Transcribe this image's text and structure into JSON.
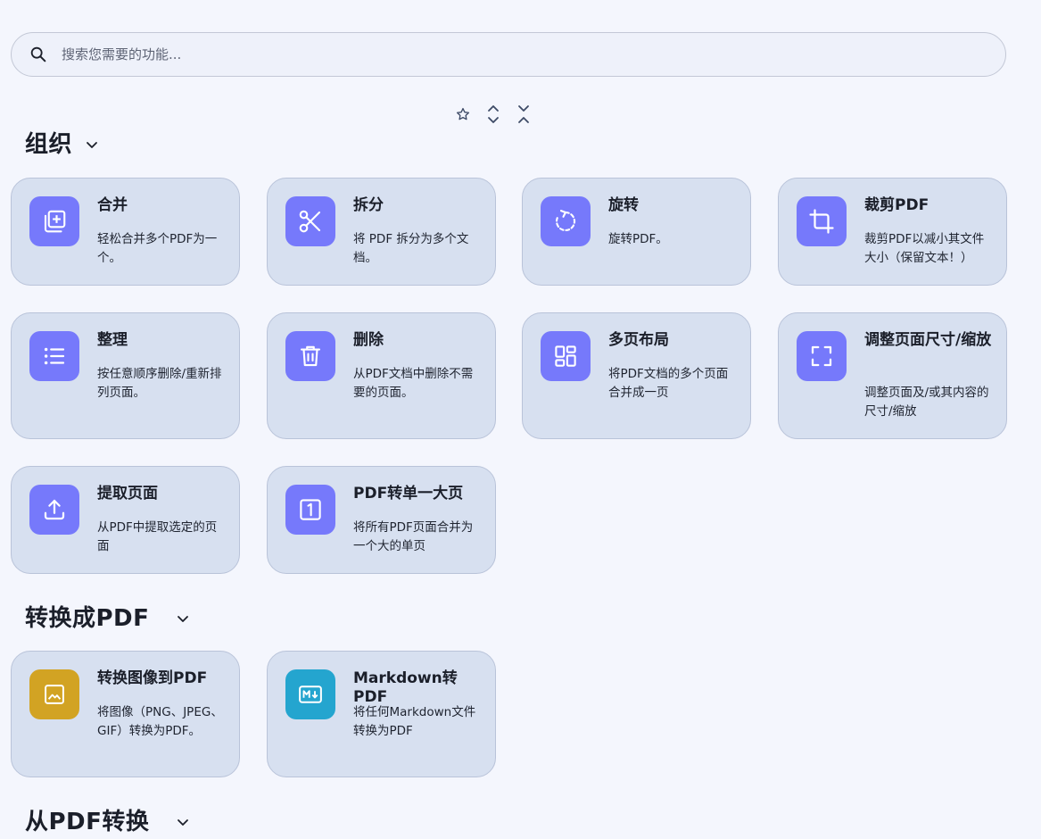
{
  "search": {
    "placeholder": "搜索您需要的功能..."
  },
  "sections": {
    "organize": {
      "title": "组织",
      "cards": {
        "merge": {
          "title": "合并",
          "desc": "轻松合并多个PDF为一个。"
        },
        "split": {
          "title": "拆分",
          "desc": "将 PDF 拆分为多个文档。"
        },
        "rotate": {
          "title": "旋转",
          "desc": "旋转PDF。"
        },
        "crop": {
          "title": "裁剪PDF",
          "desc": "裁剪PDF以减小其文件大小（保留文本！）"
        },
        "organize": {
          "title": "整理",
          "desc": "按任意顺序删除/重新排列页面。"
        },
        "remove": {
          "title": "删除",
          "desc": "从PDF文档中删除不需要的页面。"
        },
        "multi_page_layout": {
          "title": "多页布局",
          "desc": "将PDF文档的多个页面合并成一页"
        },
        "scale": {
          "title": "调整页面尺寸/缩放",
          "desc": "调整页面及/或其内容的尺寸/缩放"
        },
        "extract": {
          "title": "提取页面",
          "desc": "从PDF中提取选定的页面"
        },
        "single_page": {
          "title": "PDF转单一大页",
          "desc": "将所有PDF页面合并为一个大的单页"
        }
      }
    },
    "convert_to": {
      "title": "转换成PDF",
      "cards": {
        "image_to_pdf": {
          "title": "转换图像到PDF",
          "desc": "将图像（PNG、JPEG、GIF）转换为PDF。"
        },
        "markdown_to_pdf": {
          "title": "Markdown转PDF",
          "desc": "将任何Markdown文件转换为PDF"
        }
      }
    },
    "convert_from": {
      "title": "从PDF转换"
    }
  },
  "colors": {
    "accent": "#7679fb",
    "image_card_icon": "#d2a323",
    "markdown_card_icon": "#24a5cf",
    "card_bg": "#d7e0f0",
    "page_bg": "#f4f6fd"
  },
  "icons": {
    "search": "search-icon",
    "favorites": "star-icon",
    "collapse_all": "collapse-all-icon",
    "expand_all": "expand-all-icon"
  }
}
